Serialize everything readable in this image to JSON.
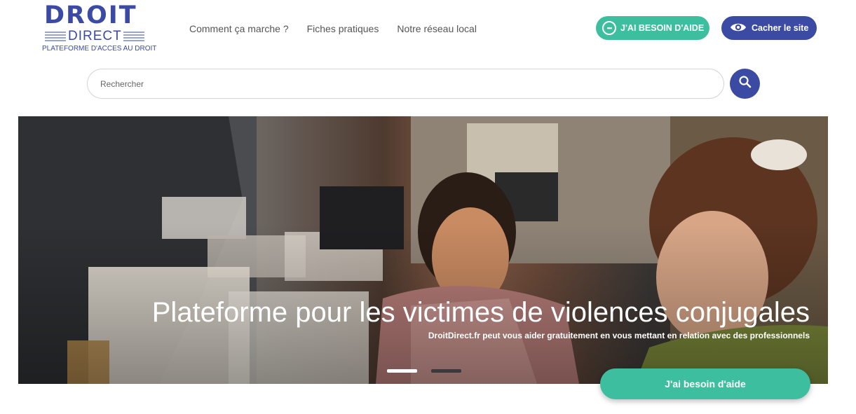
{
  "logo": {
    "main": "DROIT",
    "secondary": "DIRECT",
    "tagline": "PLATEFORME D'ACCES AU DROIT"
  },
  "nav": {
    "items": [
      {
        "label": "Comment ça marche ?"
      },
      {
        "label": "Fiches pratiques"
      },
      {
        "label": "Notre réseau local"
      }
    ]
  },
  "header": {
    "help_label": "J'AI BESOIN D'AIDE",
    "hide_label": "Cacher le site"
  },
  "search": {
    "placeholder": "Rechercher",
    "value": ""
  },
  "hero": {
    "title": "Plateforme pour les victimes de violences conjugales",
    "subtitle": "DroitDirect.fr peut vous aider gratuitement en vous mettant en relation avec des professionnels",
    "slides": {
      "count": 2,
      "active": 1
    }
  },
  "cta": {
    "help_label": "J'ai besoin d'aide"
  },
  "colors": {
    "brand_blue": "#3b4aa3",
    "accent_green": "#3dbf9f"
  },
  "icons": [
    "chat-bubble-icon",
    "eye-icon",
    "search-icon"
  ]
}
